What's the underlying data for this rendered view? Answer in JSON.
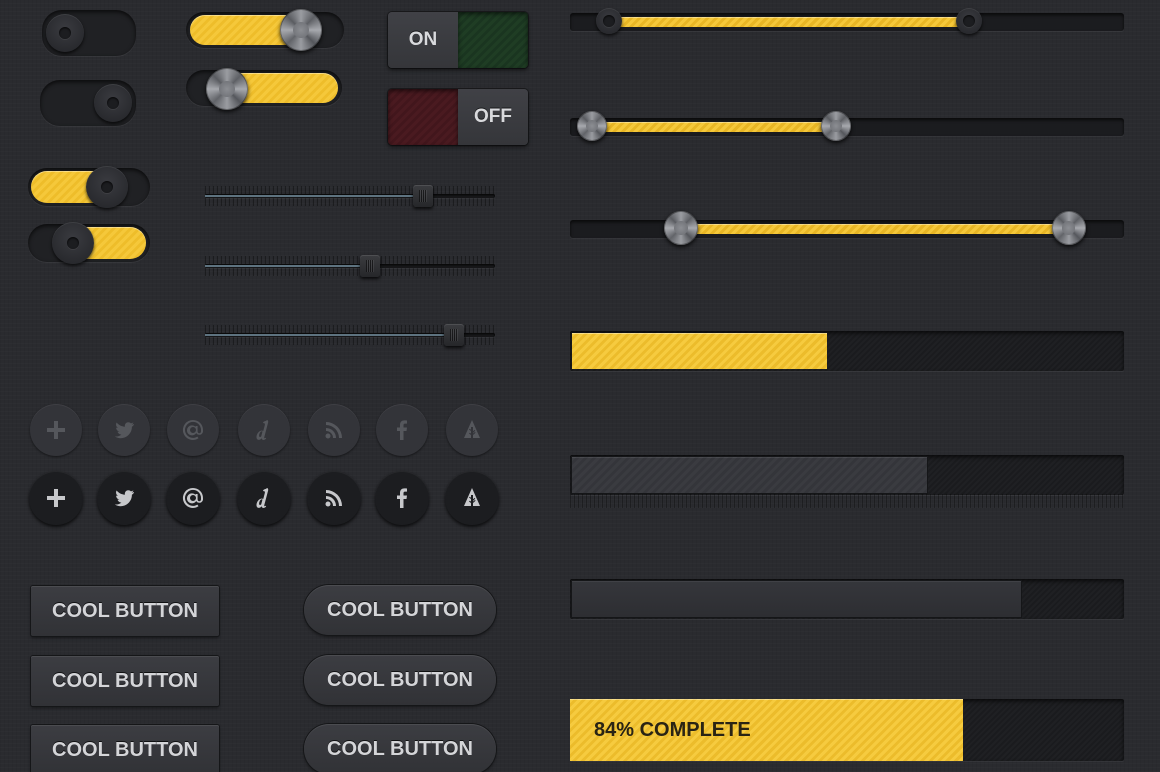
{
  "toggles": [
    {
      "name": "toggle-1",
      "state": "off",
      "color": "#202124"
    },
    {
      "name": "toggle-2",
      "state": "on",
      "color": "#202124"
    },
    {
      "name": "toggle-yellow-1",
      "state": "on",
      "fill_fraction": 0.75
    },
    {
      "name": "toggle-yellow-2",
      "state": "on",
      "fill_fraction": 0.75
    },
    {
      "name": "toggle-metal-1",
      "state": "on",
      "fill_fraction": 0.75
    },
    {
      "name": "toggle-metal-2",
      "state": "on",
      "fill_fraction": 0.75
    }
  ],
  "block_switches": {
    "on_label": "ON",
    "off_label": "OFF",
    "on_color": "#1f3d24",
    "off_color": "#4a1a20"
  },
  "tick_sliders": [
    {
      "value": 0.75
    },
    {
      "value": 0.57
    },
    {
      "value": 0.86
    }
  ],
  "social_icons": [
    {
      "name": "plus-icon",
      "glyph": "+"
    },
    {
      "name": "twitter-icon",
      "glyph": "twitter"
    },
    {
      "name": "at-icon",
      "glyph": "@"
    },
    {
      "name": "delicious-icon",
      "glyph": "d"
    },
    {
      "name": "rss-icon",
      "glyph": "rss"
    },
    {
      "name": "facebook-icon",
      "glyph": "f"
    },
    {
      "name": "forrst-icon",
      "glyph": "forrst"
    }
  ],
  "buttons": {
    "square": [
      "COOL BUTTON",
      "COOL BUTTON",
      "COOL BUTTON"
    ],
    "pill": [
      "COOL BUTTON",
      "COOL BUTTON",
      "COOL BUTTON"
    ]
  },
  "range_sliders": [
    {
      "low": 0.07,
      "high": 0.72
    },
    {
      "low": 0.04,
      "high": 0.48
    },
    {
      "low": 0.2,
      "high": 0.9
    }
  ],
  "progress_bars": [
    {
      "value": 0.46,
      "style": "yellow"
    },
    {
      "value": 0.64,
      "style": "dark"
    },
    {
      "value": 0.81,
      "style": "dark2"
    },
    {
      "value": 0.71,
      "style": "yellow",
      "label": "84% COMPLETE"
    }
  ],
  "colors": {
    "accent_yellow": "#f5c83a",
    "background": "#2a2b2f"
  }
}
